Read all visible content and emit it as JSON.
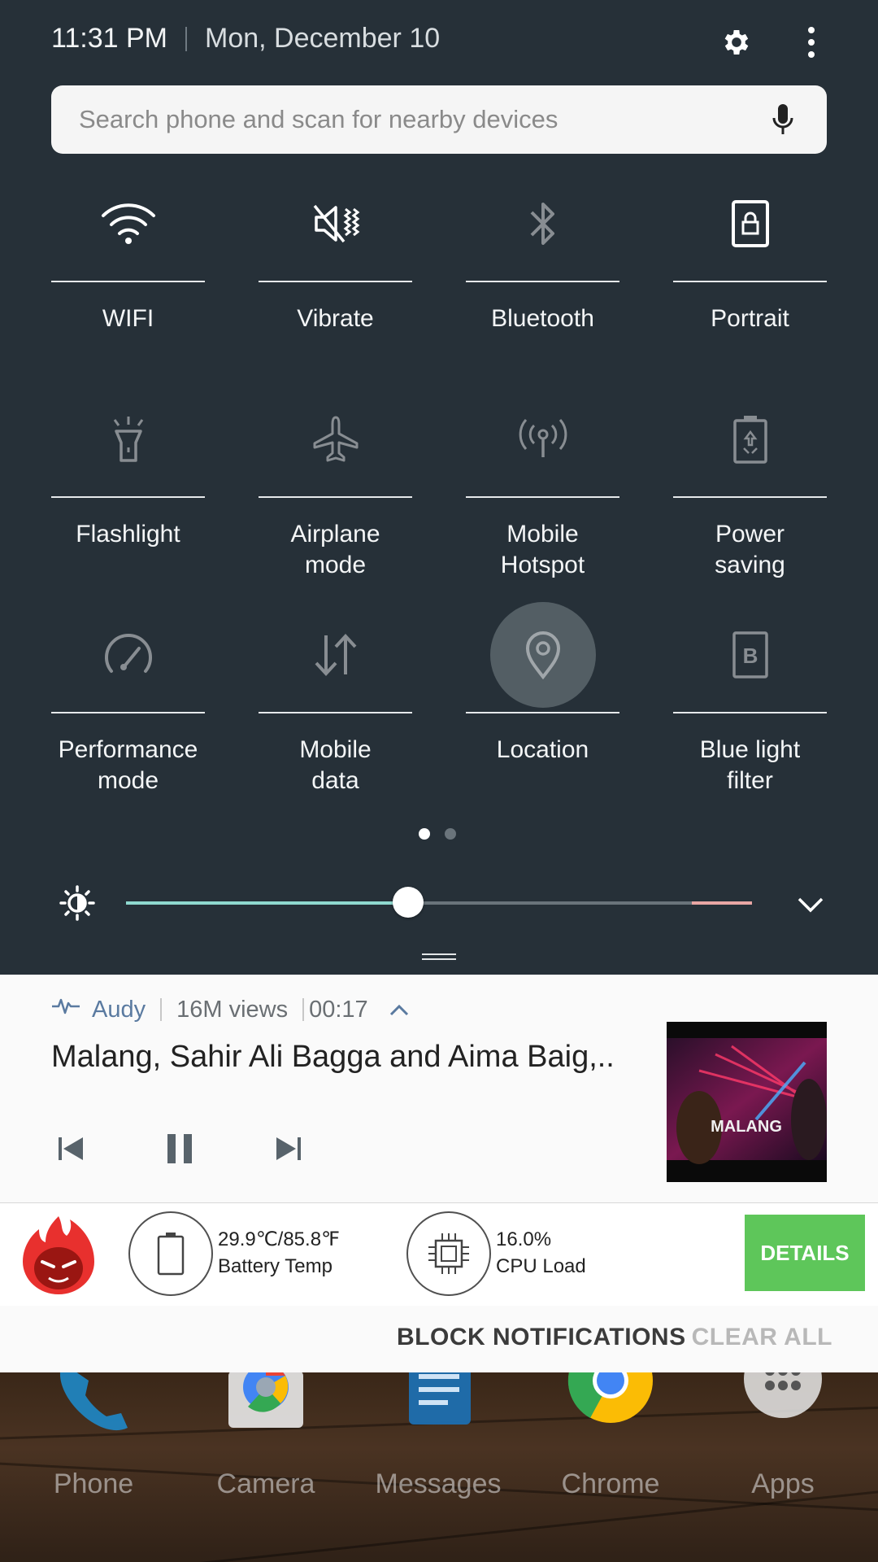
{
  "status": {
    "time": "11:31 PM",
    "date": "Mon, December 10"
  },
  "search": {
    "placeholder": "Search phone and scan for nearby devices"
  },
  "tiles": [
    {
      "label": "WIFI",
      "icon": "wifi-icon",
      "active": true
    },
    {
      "label": "Vibrate",
      "icon": "vibrate-icon",
      "active": true
    },
    {
      "label": "Bluetooth",
      "icon": "bluetooth-icon",
      "active": false
    },
    {
      "label": "Portrait",
      "icon": "portrait-lock-icon",
      "active": true
    },
    {
      "label": "Flashlight",
      "icon": "flashlight-icon",
      "active": false
    },
    {
      "label": "Airplane\nmode",
      "icon": "airplane-icon",
      "active": false
    },
    {
      "label": "Mobile\nHotspot",
      "icon": "hotspot-icon",
      "active": false
    },
    {
      "label": "Power\nsaving",
      "icon": "battery-saver-icon",
      "active": false
    },
    {
      "label": "Performance\nmode",
      "icon": "speedometer-icon",
      "active": false
    },
    {
      "label": "Mobile\ndata",
      "icon": "data-arrows-icon",
      "active": false
    },
    {
      "label": "Location",
      "icon": "location-pin-icon",
      "active": false
    },
    {
      "label": "Blue light\nfilter",
      "icon": "blue-light-filter-icon",
      "active": false
    }
  ],
  "pager": {
    "pages": 2,
    "current": 1
  },
  "brightness": {
    "level": 0.45
  },
  "media": {
    "app": "Audy",
    "views": "16M views",
    "elapsed": "00:17",
    "title": "Malang, Sahir Ali Bagga and Aima Baig,..",
    "thumbnail_text": "MALANG"
  },
  "antutu": {
    "battery_temp_value": "29.9℃/85.8℉",
    "battery_temp_label": "Battery Temp",
    "cpu_value": "16.0%",
    "cpu_label": "CPU Load",
    "details_label": "DETAILS"
  },
  "actions": {
    "block": "BLOCK NOTIFICATIONS",
    "clear": "CLEAR ALL"
  },
  "dock": [
    {
      "label": "Phone"
    },
    {
      "label": "Camera"
    },
    {
      "label": "Messages"
    },
    {
      "label": "Chrome"
    },
    {
      "label": "Apps"
    }
  ]
}
